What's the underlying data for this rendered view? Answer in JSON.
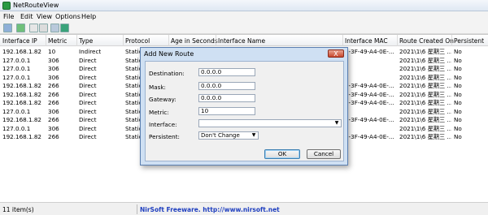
{
  "window": {
    "title": "NetRouteView"
  },
  "menu": [
    "File",
    "Edit",
    "View",
    "Options",
    "Help"
  ],
  "toolbar": {
    "icons": [
      "save-icon",
      "refresh-icon",
      "copy-icon",
      "properties-icon",
      "find-icon",
      "exit-icon"
    ]
  },
  "columns": [
    "Interface IP",
    "Metric",
    "Type",
    "Protocol",
    "Age in Seconds",
    "Interface Name",
    "Interface MAC",
    "Route Created On",
    "Persistent"
  ],
  "rows": [
    [
      "192.168.1.82",
      "10",
      "Indirect",
      "Static",
      "",
      "",
      "0-3F-49-A4-0E-...",
      "2021\\1\\6 星期三 ...",
      "No"
    ],
    [
      "127.0.0.1",
      "306",
      "Direct",
      "Static",
      "",
      "",
      "",
      "2021\\1\\6 星期三 ...",
      "No"
    ],
    [
      "127.0.0.1",
      "306",
      "Direct",
      "Static",
      "",
      "",
      "",
      "2021\\1\\6 星期三 ...",
      "No"
    ],
    [
      "127.0.0.1",
      "306",
      "Direct",
      "Static",
      "",
      "",
      "",
      "2021\\1\\6 星期三 ...",
      "No"
    ],
    [
      "192.168.1.82",
      "266",
      "Direct",
      "Static",
      "",
      "",
      "0-3F-49-A4-0E-...",
      "2021\\1\\6 星期三 ...",
      "No"
    ],
    [
      "192.168.1.82",
      "266",
      "Direct",
      "Static",
      "",
      "",
      "0-3F-49-A4-0E-...",
      "2021\\1\\6 星期三 ...",
      "No"
    ],
    [
      "192.168.1.82",
      "266",
      "Direct",
      "Static",
      "",
      "",
      "0-3F-49-A4-0E-...",
      "2021\\1\\6 星期三 ...",
      "No"
    ],
    [
      "127.0.0.1",
      "306",
      "Direct",
      "Static",
      "",
      "",
      "",
      "2021\\1\\6 星期三 ...",
      "No"
    ],
    [
      "192.168.1.82",
      "266",
      "Direct",
      "Static",
      "",
      "",
      "0-3F-49-A4-0E-...",
      "2021\\1\\6 星期三 ...",
      "No"
    ],
    [
      "127.0.0.1",
      "306",
      "Direct",
      "Static",
      "",
      "",
      "",
      "2021\\1\\6 星期三 ...",
      "No"
    ],
    [
      "192.168.1.82",
      "266",
      "Direct",
      "Static",
      "",
      "",
      "0-3F-49-A4-0E-...",
      "2021\\1\\6 星期三 ...",
      "No"
    ]
  ],
  "status": {
    "count": "11 item(s)",
    "link": "NirSoft Freeware.  http://www.nirsoft.net"
  },
  "dialog": {
    "title": "Add New Route",
    "close_label": "X",
    "fields": [
      {
        "label": "Destination:",
        "value": "0.0.0.0"
      },
      {
        "label": "Mask:",
        "value": "0.0.0.0"
      },
      {
        "label": "Gateway:",
        "value": "0.0.0.0"
      },
      {
        "label": "Metric:",
        "value": "10"
      }
    ],
    "interface_label": "Interface:",
    "interface_value": "",
    "persistent_label": "Persistent:",
    "persistent_value": "Don't Change",
    "ok_label": "OK",
    "cancel_label": "Cancel"
  }
}
